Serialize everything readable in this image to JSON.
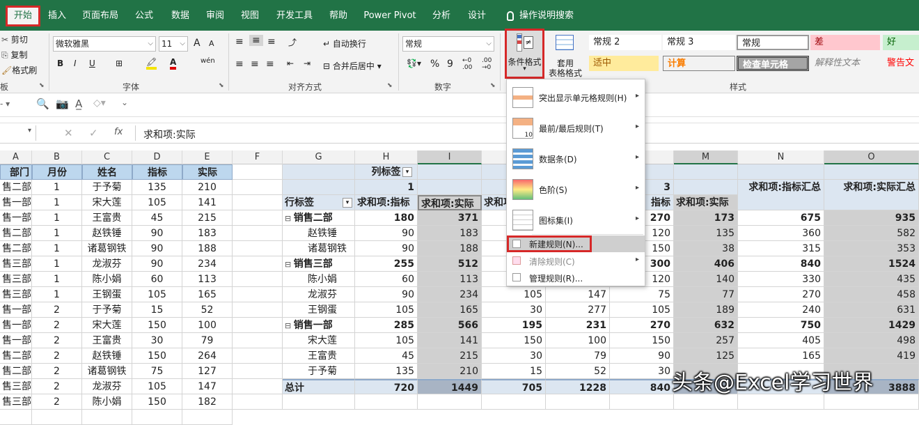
{
  "tabs": [
    {
      "label": "开始",
      "active": true
    },
    {
      "label": "插入"
    },
    {
      "label": "页面布局"
    },
    {
      "label": "公式"
    },
    {
      "label": "数据"
    },
    {
      "label": "审阅"
    },
    {
      "label": "视图"
    },
    {
      "label": "开发工具"
    },
    {
      "label": "帮助"
    },
    {
      "label": "Power Pivot"
    },
    {
      "label": "分析"
    },
    {
      "label": "设计"
    },
    {
      "label": "操作说明搜索"
    }
  ],
  "ribbon": {
    "clipboard": {
      "cut": "剪切",
      "copy": "复制",
      "format_painter": "格式刷",
      "group": "板"
    },
    "font": {
      "name": "微软雅黑",
      "size": "11",
      "group": "字体",
      "bold": "B",
      "italic": "I",
      "underline": "U",
      "phonetic": "wén",
      "grow": "A",
      "shrink": "A"
    },
    "alignment": {
      "wrap": "自动换行",
      "merge": "合并后居中",
      "group": "对齐方式"
    },
    "number": {
      "format": "常规",
      "percent": "%",
      "comma": "9",
      "group": "数字"
    },
    "conditional_format": {
      "label": "条件格式"
    },
    "table_format": {
      "line1": "套用",
      "line2": "表格格式"
    },
    "styles": {
      "group": "样式",
      "cells": [
        {
          "label": "常规 2"
        },
        {
          "label": "常规 3"
        },
        {
          "label": "常规"
        },
        {
          "label": "差"
        },
        {
          "label": "好"
        },
        {
          "label": "适中"
        },
        {
          "label": "计算"
        },
        {
          "label": "检查单元格"
        },
        {
          "label": "解释性文本"
        },
        {
          "label": "警告文"
        }
      ]
    }
  },
  "formula_bar": {
    "fx": "fx",
    "content": "求和项:实际"
  },
  "columns": [
    "A",
    "B",
    "C",
    "D",
    "E",
    "F",
    "G",
    "H",
    "I",
    "",
    "",
    "",
    "M",
    "N",
    "O"
  ],
  "left_table": {
    "headers": [
      "部门",
      "月份",
      "姓名",
      "指标",
      "实际"
    ],
    "rows": [
      [
        "售二部",
        "1",
        "于予菊",
        "135",
        "210"
      ],
      [
        "售一部",
        "1",
        "宋大莲",
        "105",
        "141"
      ],
      [
        "售一部",
        "1",
        "王富贵",
        "45",
        "215"
      ],
      [
        "售二部",
        "1",
        "赵铁锤",
        "90",
        "183"
      ],
      [
        "售二部",
        "1",
        "诸葛钢铁",
        "90",
        "188"
      ],
      [
        "售三部",
        "1",
        "龙淑芬",
        "90",
        "234"
      ],
      [
        "售三部",
        "1",
        "陈小娟",
        "60",
        "113"
      ],
      [
        "售三部",
        "1",
        "王钢蛋",
        "105",
        "165"
      ],
      [
        "售一部",
        "2",
        "于予菊",
        "15",
        "52"
      ],
      [
        "售一部",
        "2",
        "宋大莲",
        "150",
        "100"
      ],
      [
        "售一部",
        "2",
        "王富贵",
        "30",
        "79"
      ],
      [
        "售二部",
        "2",
        "赵铁锤",
        "150",
        "264"
      ],
      [
        "售二部",
        "2",
        "诸葛钢铁",
        "75",
        "127"
      ],
      [
        "售三部",
        "2",
        "龙淑芬",
        "105",
        "147"
      ],
      [
        "售三部",
        "2",
        "陈小娟",
        "150",
        "182"
      ]
    ]
  },
  "pivot": {
    "col_label": "列标签",
    "row_label": "行标签",
    "col1": "1",
    "col3": "3",
    "hdr_target": "求和项:指标",
    "hdr_actual": "求和项:实际",
    "hdr_partial": "求和项:",
    "hdr_target_partial": "指标",
    "hdr_total_target": "求和项:指标汇总",
    "hdr_total_actual": "求和项:实际汇总",
    "rows": [
      {
        "label": "销售二部",
        "group": true,
        "h": "180",
        "i": "371",
        "l": "270",
        "m": "173",
        "n": "675",
        "o": "935"
      },
      {
        "label": "赵铁锤",
        "h": "90",
        "i": "183",
        "l": "120",
        "m": "135",
        "n": "360",
        "o": "582"
      },
      {
        "label": "诸葛钢铁",
        "h": "90",
        "i": "188",
        "l": "150",
        "m": "38",
        "n": "315",
        "o": "353"
      },
      {
        "label": "销售三部",
        "group": true,
        "h": "255",
        "i": "512",
        "l": "300",
        "m": "406",
        "n": "840",
        "o": "1524"
      },
      {
        "label": "陈小娟",
        "h": "60",
        "i": "113",
        "l": "120",
        "m": "140",
        "n": "330",
        "o": "435"
      },
      {
        "label": "龙淑芬",
        "h": "90",
        "i": "234",
        "j": "105",
        "k": "147",
        "l": "75",
        "m": "77",
        "n": "270",
        "o": "458"
      },
      {
        "label": "王钢蛋",
        "h": "105",
        "i": "165",
        "j": "30",
        "k": "277",
        "l": "105",
        "m": "189",
        "n": "240",
        "o": "631"
      },
      {
        "label": "销售一部",
        "group": true,
        "h": "285",
        "i": "566",
        "j": "195",
        "k": "231",
        "l": "270",
        "m": "632",
        "n": "750",
        "o": "1429"
      },
      {
        "label": "宋大莲",
        "h": "105",
        "i": "141",
        "j": "150",
        "k": "100",
        "l": "150",
        "m": "257",
        "n": "405",
        "o": "498"
      },
      {
        "label": "王富贵",
        "h": "45",
        "i": "215",
        "j": "30",
        "k": "79",
        "l": "90",
        "m": "125",
        "n": "165",
        "o": "419"
      },
      {
        "label": "于予菊",
        "h": "135",
        "i": "210",
        "j": "15",
        "k": "52",
        "l": "30",
        "m": "",
        "n": "",
        "o": ""
      }
    ],
    "total": {
      "label": "总计",
      "h": "720",
      "i": "1449",
      "j": "705",
      "k": "1228",
      "l": "840",
      "m": "",
      "n": "",
      "o": "3888"
    }
  },
  "menu": {
    "items": [
      {
        "label": "突出显示单元格规则(H)",
        "submenu": true
      },
      {
        "label": "最前/最后规则(T)",
        "submenu": true
      },
      {
        "label": "数据条(D)",
        "submenu": true
      },
      {
        "label": "色阶(S)",
        "submenu": true
      },
      {
        "label": "图标集(I)",
        "submenu": true
      },
      {
        "label": "新建规则(N)...",
        "highlight": true
      },
      {
        "label": "清除规则(C)",
        "submenu": true
      },
      {
        "label": "管理规则(R)..."
      }
    ]
  },
  "watermark": "头条@Excel学习世界",
  "colors": {
    "accent": "#217346",
    "highlight_border": "#d62828",
    "pivot_header": "#dce6f1",
    "selected_col": "#d0d0d0"
  }
}
